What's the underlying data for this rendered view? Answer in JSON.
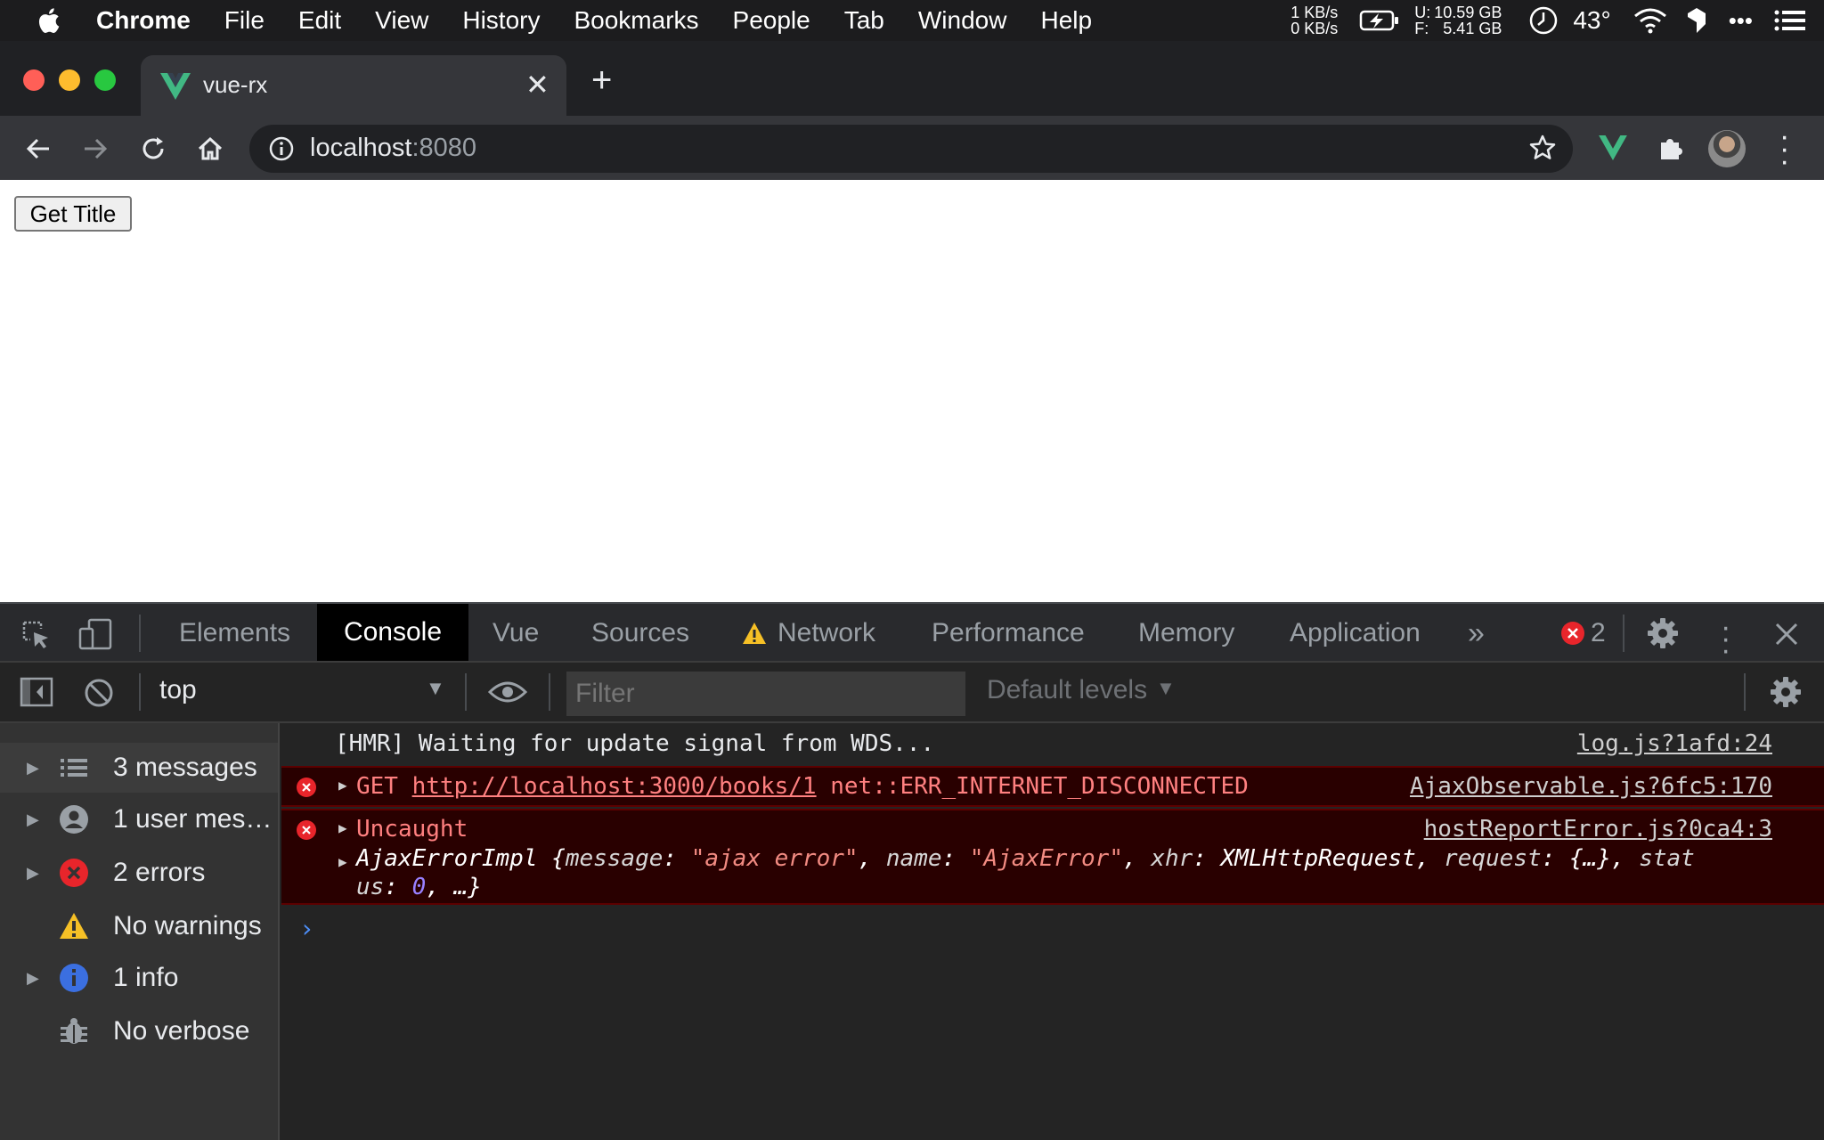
{
  "menubar": {
    "app": "Chrome",
    "items": [
      "File",
      "Edit",
      "View",
      "History",
      "Bookmarks",
      "People",
      "Tab",
      "Window",
      "Help"
    ],
    "net_up": "1 KB/s",
    "net_down": "0 KB/s",
    "disk_u_label": "U:",
    "disk_f_label": "F:",
    "disk_u": "10.59 GB",
    "disk_f": "5.41 GB",
    "temp": "43°"
  },
  "browser": {
    "tab_title": "vue-rx",
    "url_host": "localhost",
    "url_port": ":8080"
  },
  "page": {
    "button_label": "Get Title"
  },
  "devtools": {
    "tabs": [
      "Elements",
      "Console",
      "Vue",
      "Sources",
      "Network",
      "Performance",
      "Memory",
      "Application"
    ],
    "active_tab": "Console",
    "error_count": "2",
    "context": "top",
    "filter_placeholder": "Filter",
    "levels": "Default levels",
    "sidebar": [
      {
        "label": "3 messages",
        "icon": "list-icon"
      },
      {
        "label": "1 user mes…",
        "icon": "user-icon"
      },
      {
        "label": "2 errors",
        "icon": "error-icon"
      },
      {
        "label": "No warnings",
        "icon": "warning-icon"
      },
      {
        "label": "1 info",
        "icon": "info-icon"
      },
      {
        "label": "No verbose",
        "icon": "bug-icon"
      }
    ],
    "messages": [
      {
        "text": "[HMR] Waiting for update signal from WDS...",
        "source": "log.js?1afd:24"
      },
      {
        "method": "GET",
        "url": "http://localhost:3000/books/1",
        "error": "net::ERR_INTERNET_DISCONNECTED",
        "source": "AjaxObservable.js?6fc5:170"
      },
      {
        "label": "Uncaught",
        "source": "hostReportError.js?0ca4:3",
        "obj_name": "AjaxErrorImpl",
        "k_message": "message",
        "v_message": "\"ajax error\"",
        "k_name": "name",
        "v_name": "\"AjaxError\"",
        "k_xhr": "xhr",
        "v_xhr": "XMLHttpRequest",
        "k_request": "request",
        "v_request": "{…}",
        "k_status1": "stat",
        "k_status2": "us",
        "v_status": "0",
        "rest": "…}"
      }
    ]
  },
  "colors": {
    "vue_green": "#41b883",
    "error_red": "#e8252b",
    "warning_yellow": "#f6c026",
    "info_blue": "#3b6fe0"
  }
}
